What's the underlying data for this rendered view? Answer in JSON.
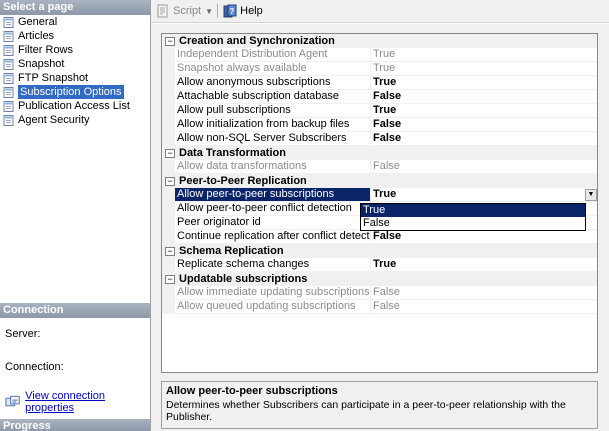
{
  "left_pane": {
    "header": "Select a page",
    "items": [
      {
        "label": "General",
        "icon": "page-icon",
        "selected": false
      },
      {
        "label": "Articles",
        "icon": "page-icon",
        "selected": false
      },
      {
        "label": "Filter Rows",
        "icon": "page-icon",
        "selected": false
      },
      {
        "label": "Snapshot",
        "icon": "page-icon",
        "selected": false
      },
      {
        "label": "FTP Snapshot",
        "icon": "page-icon",
        "selected": false
      },
      {
        "label": "Subscription Options",
        "icon": "page-icon",
        "selected": true
      },
      {
        "label": "Publication Access List",
        "icon": "page-icon",
        "selected": false
      },
      {
        "label": "Agent Security",
        "icon": "page-icon",
        "selected": false
      }
    ],
    "connection": {
      "header": "Connection",
      "server_label": "Server:",
      "connection_label": "Connection:",
      "view_link": "View connection properties"
    },
    "progress_header": "Progress"
  },
  "toolbar": {
    "script_label": "Script",
    "help_label": "Help"
  },
  "grid": {
    "categories": [
      {
        "title": "Creation and Synchronization",
        "rows": [
          {
            "name": "Independent Distribution Agent",
            "value": "True",
            "disabled": true
          },
          {
            "name": "Snapshot always available",
            "value": "True",
            "disabled": true
          },
          {
            "name": "Allow anonymous subscriptions",
            "value": "True",
            "disabled": false
          },
          {
            "name": "Attachable subscription database",
            "value": "False",
            "disabled": false
          },
          {
            "name": "Allow pull subscriptions",
            "value": "True",
            "disabled": false
          },
          {
            "name": "Allow initialization from backup files",
            "value": "False",
            "disabled": false
          },
          {
            "name": "Allow non-SQL Server Subscribers",
            "value": "False",
            "disabled": false
          }
        ]
      },
      {
        "title": "Data Transformation",
        "rows": [
          {
            "name": "Allow data transformations",
            "value": "False",
            "disabled": true
          }
        ]
      },
      {
        "title": "Peer-to-Peer Replication",
        "rows": [
          {
            "name": "Allow peer-to-peer subscriptions",
            "value": "True",
            "disabled": false,
            "selected": true
          },
          {
            "name": "Allow peer-to-peer conflict detection",
            "value": "",
            "disabled": false
          },
          {
            "name": "Peer originator id",
            "value": "",
            "disabled": false
          },
          {
            "name": "Continue replication after conflict detection",
            "value": "False",
            "disabled": false
          }
        ]
      },
      {
        "title": "Schema Replication",
        "rows": [
          {
            "name": "Replicate schema changes",
            "value": "True",
            "disabled": false
          }
        ]
      },
      {
        "title": "Updatable subscriptions",
        "rows": [
          {
            "name": "Allow immediate updating subscriptions",
            "value": "False",
            "disabled": true
          },
          {
            "name": "Allow queued updating subscriptions",
            "value": "False",
            "disabled": true
          }
        ]
      }
    ],
    "dropdown_options": [
      "True",
      "False"
    ],
    "dropdown_highlight": 0
  },
  "description": {
    "title": "Allow peer-to-peer subscriptions",
    "text": "Determines whether Subscribers can participate in a peer-to-peer relationship with the Publisher."
  }
}
